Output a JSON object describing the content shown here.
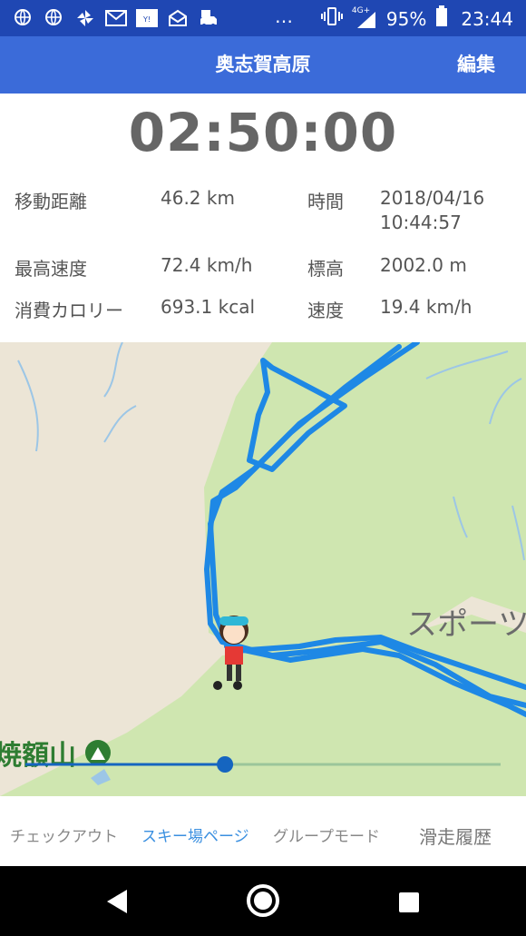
{
  "status_bar": {
    "icons": [
      "globe-search-icon",
      "globe-search-icon",
      "pinwheel-icon",
      "mail-icon",
      "yahoo-icon",
      "envelope-icon",
      "car-icon"
    ],
    "overflow": "…",
    "network": "4G+",
    "battery": "95%",
    "time": "23:44"
  },
  "app_bar": {
    "title": "奥志賀高原",
    "edit_label": "編集"
  },
  "timer": "02:50:00",
  "stats": {
    "distance_label": "移動距離",
    "distance_value": "46.2 km",
    "time_label": "時間",
    "date_value": "2018/04/16",
    "clock_value": "10:44:57",
    "max_speed_label": "最高速度",
    "max_speed_value": "72.4 km/h",
    "altitude_label": "標高",
    "altitude_value": "2002.0 m",
    "calories_label": "消費カロリー",
    "calories_value": "693.1 kcal",
    "speed_label": "速度",
    "speed_value": "19.4 km/h"
  },
  "map": {
    "sports_label": "スポーツ",
    "mountain_label": "焼額山",
    "playback_progress": 0.42,
    "colors": {
      "track": "#1e88e5",
      "slider": "#1565c0",
      "green": "#cfe6b0",
      "water": "#9cc6e6"
    }
  },
  "bottom_nav": {
    "checkout": "チェックアウト",
    "ski_page": "スキー場ページ",
    "group_mode": "グループモード",
    "history": "滑走履歴"
  }
}
